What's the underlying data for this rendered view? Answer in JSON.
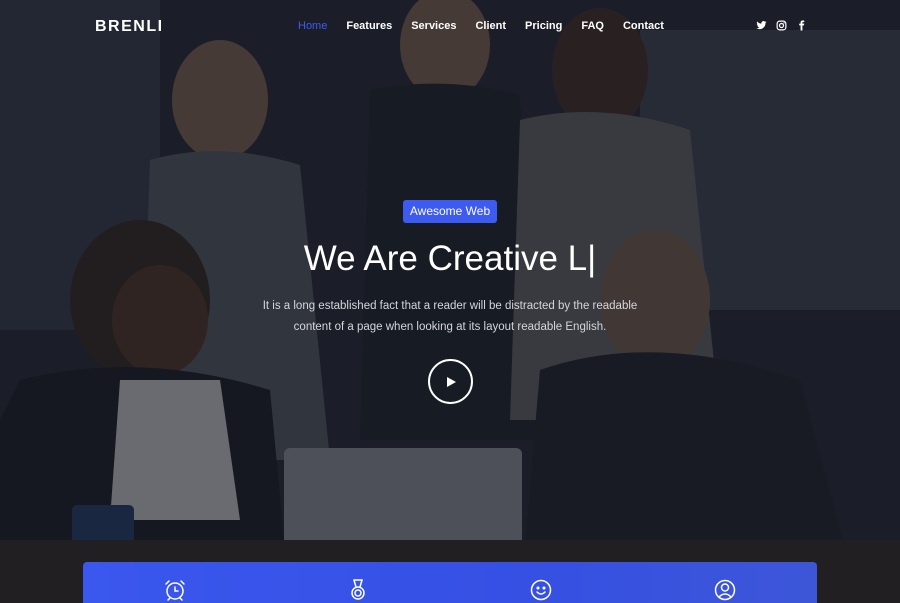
{
  "brand": {
    "logo": "BRENLI"
  },
  "nav": {
    "items": [
      {
        "label": "Home",
        "active": true
      },
      {
        "label": "Features",
        "active": false
      },
      {
        "label": "Services",
        "active": false
      },
      {
        "label": "Client",
        "active": false
      },
      {
        "label": "Pricing",
        "active": false
      },
      {
        "label": "FAQ",
        "active": false
      },
      {
        "label": "Contact",
        "active": false
      }
    ]
  },
  "social": {
    "icons": [
      "twitter-icon",
      "instagram-icon",
      "facebook-icon"
    ]
  },
  "hero": {
    "badge": "Awesome Web",
    "headline": "We Are Creative L",
    "cursor": "|",
    "description": "It is a long established fact that a reader will be distracted by the readable content of a page when looking at its layout readable English.",
    "play_icon": "play-icon"
  },
  "features": {
    "icons": [
      "alarm-clock-icon",
      "medal-icon",
      "smile-icon",
      "user-icon"
    ]
  },
  "colors": {
    "accent": "#3d5af1",
    "text": "#ffffff",
    "muted": "#d4d6dc"
  }
}
